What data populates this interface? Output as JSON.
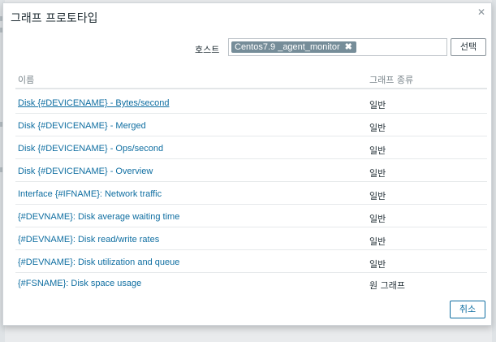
{
  "dialog": {
    "title": "그래프 프로토타입",
    "close_icon": "close-icon"
  },
  "filter": {
    "host_label": "호스트",
    "host_tag": "Centos7.9 _agent_monitor",
    "host_tag_remove": "✖",
    "select_button": "선택"
  },
  "table": {
    "columns": [
      "이름",
      "그래프 종류"
    ],
    "rows": [
      {
        "name": "Disk {#DEVICENAME} - Bytes/second",
        "type": "일반"
      },
      {
        "name": "Disk {#DEVICENAME} - Merged",
        "type": "일반"
      },
      {
        "name": "Disk {#DEVICENAME} - Ops/second",
        "type": "일반"
      },
      {
        "name": "Disk {#DEVICENAME} - Overview",
        "type": "일반"
      },
      {
        "name": "Interface {#IFNAME}: Network traffic",
        "type": "일반"
      },
      {
        "name": "{#DEVNAME}: Disk average waiting time",
        "type": "일반"
      },
      {
        "name": "{#DEVNAME}: Disk read/write rates",
        "type": "일반"
      },
      {
        "name": "{#DEVNAME}: Disk utilization and queue",
        "type": "일반"
      },
      {
        "name": "{#FSNAME}: Disk space usage",
        "type": "원 그래프"
      }
    ]
  },
  "footer": {
    "cancel_button": "취소"
  },
  "colors": {
    "link": "#0f6ea1",
    "tag_bg": "#768d99",
    "overlay": "#e9ebed"
  }
}
